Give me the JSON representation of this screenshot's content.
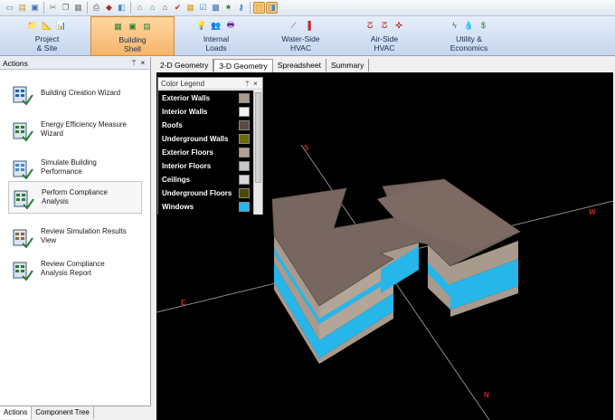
{
  "toolbar": {
    "buttons": [
      {
        "icon": "new-project-icon",
        "glyph": "▭"
      },
      {
        "icon": "open-folder-icon",
        "glyph": "▤"
      },
      {
        "icon": "save-icon",
        "glyph": "▣"
      },
      {
        "icon": "cut-icon",
        "glyph": "✂"
      },
      {
        "icon": "copy-icon",
        "glyph": "❐"
      },
      {
        "icon": "paste-icon",
        "glyph": "▦"
      },
      {
        "icon": "print-icon",
        "glyph": "⎙"
      },
      {
        "icon": "material-icon",
        "glyph": "◆"
      },
      {
        "icon": "layers-icon",
        "glyph": "◧"
      },
      {
        "icon": "house-icon",
        "glyph": "⌂"
      },
      {
        "icon": "house-export-icon",
        "glyph": "⌂"
      },
      {
        "icon": "house-import-icon",
        "glyph": "⌂"
      },
      {
        "icon": "check-icon",
        "glyph": "✔"
      },
      {
        "icon": "table-icon",
        "glyph": "▦"
      },
      {
        "icon": "check-list-icon",
        "glyph": "☑"
      },
      {
        "icon": "grid-icon",
        "glyph": "▩"
      },
      {
        "icon": "gear-icon",
        "glyph": "✷"
      },
      {
        "icon": "key-icon",
        "glyph": "⚷"
      },
      {
        "icon": "view-3d-icon",
        "glyph": "◫"
      },
      {
        "icon": "view-split-icon",
        "glyph": "◨"
      }
    ]
  },
  "ribbon": {
    "groups": [
      {
        "label": "Project\n& Site",
        "icons": [
          "📁",
          "📐",
          "📊"
        ]
      },
      {
        "label": "Building\nShell",
        "icons": [
          "▦",
          "▣",
          "▤"
        ]
      },
      {
        "label": "Internal\nLoads",
        "icons": [
          "💡",
          "👥",
          "🖶"
        ]
      },
      {
        "label": "Water-Side\nHVAC",
        "icons": [
          "⟋",
          "▐"
        ]
      },
      {
        "label": "Air-Side\nHVAC",
        "icons": [
          "ⵒ",
          "ⵒ",
          "✜"
        ]
      },
      {
        "label": "Utility &\nEconomics",
        "icons": [
          "ϟ",
          "💧",
          "$"
        ]
      }
    ]
  },
  "actions_panel": {
    "title": "Actions",
    "pin": "ᛘ",
    "close": "×",
    "items": [
      {
        "label": "Building Creation Wizard"
      },
      {
        "label": "Energy Efficiency Measure\nWizard"
      },
      {
        "label": "Simulate Building\nPerformance"
      },
      {
        "label": "Perform Compliance\nAnalysis"
      },
      {
        "label": "Review Simulation Results\nView"
      },
      {
        "label": "Review Compliance\nAnalysis Report"
      }
    ],
    "bottom_tabs": [
      "Actions",
      "Component Tree"
    ]
  },
  "view_tabs": [
    "2-D Geometry",
    "3-D Geometry",
    "Spreadsheet",
    "Summary"
  ],
  "legend": {
    "title": "Color Legend",
    "pin": "ᛘ",
    "close": "×",
    "items": [
      {
        "name": "Exterior Walls",
        "color": "#a89a8c"
      },
      {
        "name": "Interior Walls",
        "color": "#f0f0f0"
      },
      {
        "name": "Roofs",
        "color": "#5a4a44"
      },
      {
        "name": "Underground Walls",
        "color": "#6b6b00"
      },
      {
        "name": "Exterior Floors",
        "color": "#b5a090"
      },
      {
        "name": "Interior Floors",
        "color": "#c8c8c8"
      },
      {
        "name": "Ceilings",
        "color": "#d8d8d8"
      },
      {
        "name": "Underground Floors",
        "color": "#4a4a00"
      },
      {
        "name": "Windows",
        "color": "#26b6ea"
      }
    ]
  },
  "compass": {
    "s": "S",
    "e": "E",
    "w": "W",
    "n": "N"
  },
  "colors": {
    "roof": "#786660",
    "wall": "#a89a8c",
    "window": "#26b6ea",
    "axis": "#8c8c8c"
  }
}
